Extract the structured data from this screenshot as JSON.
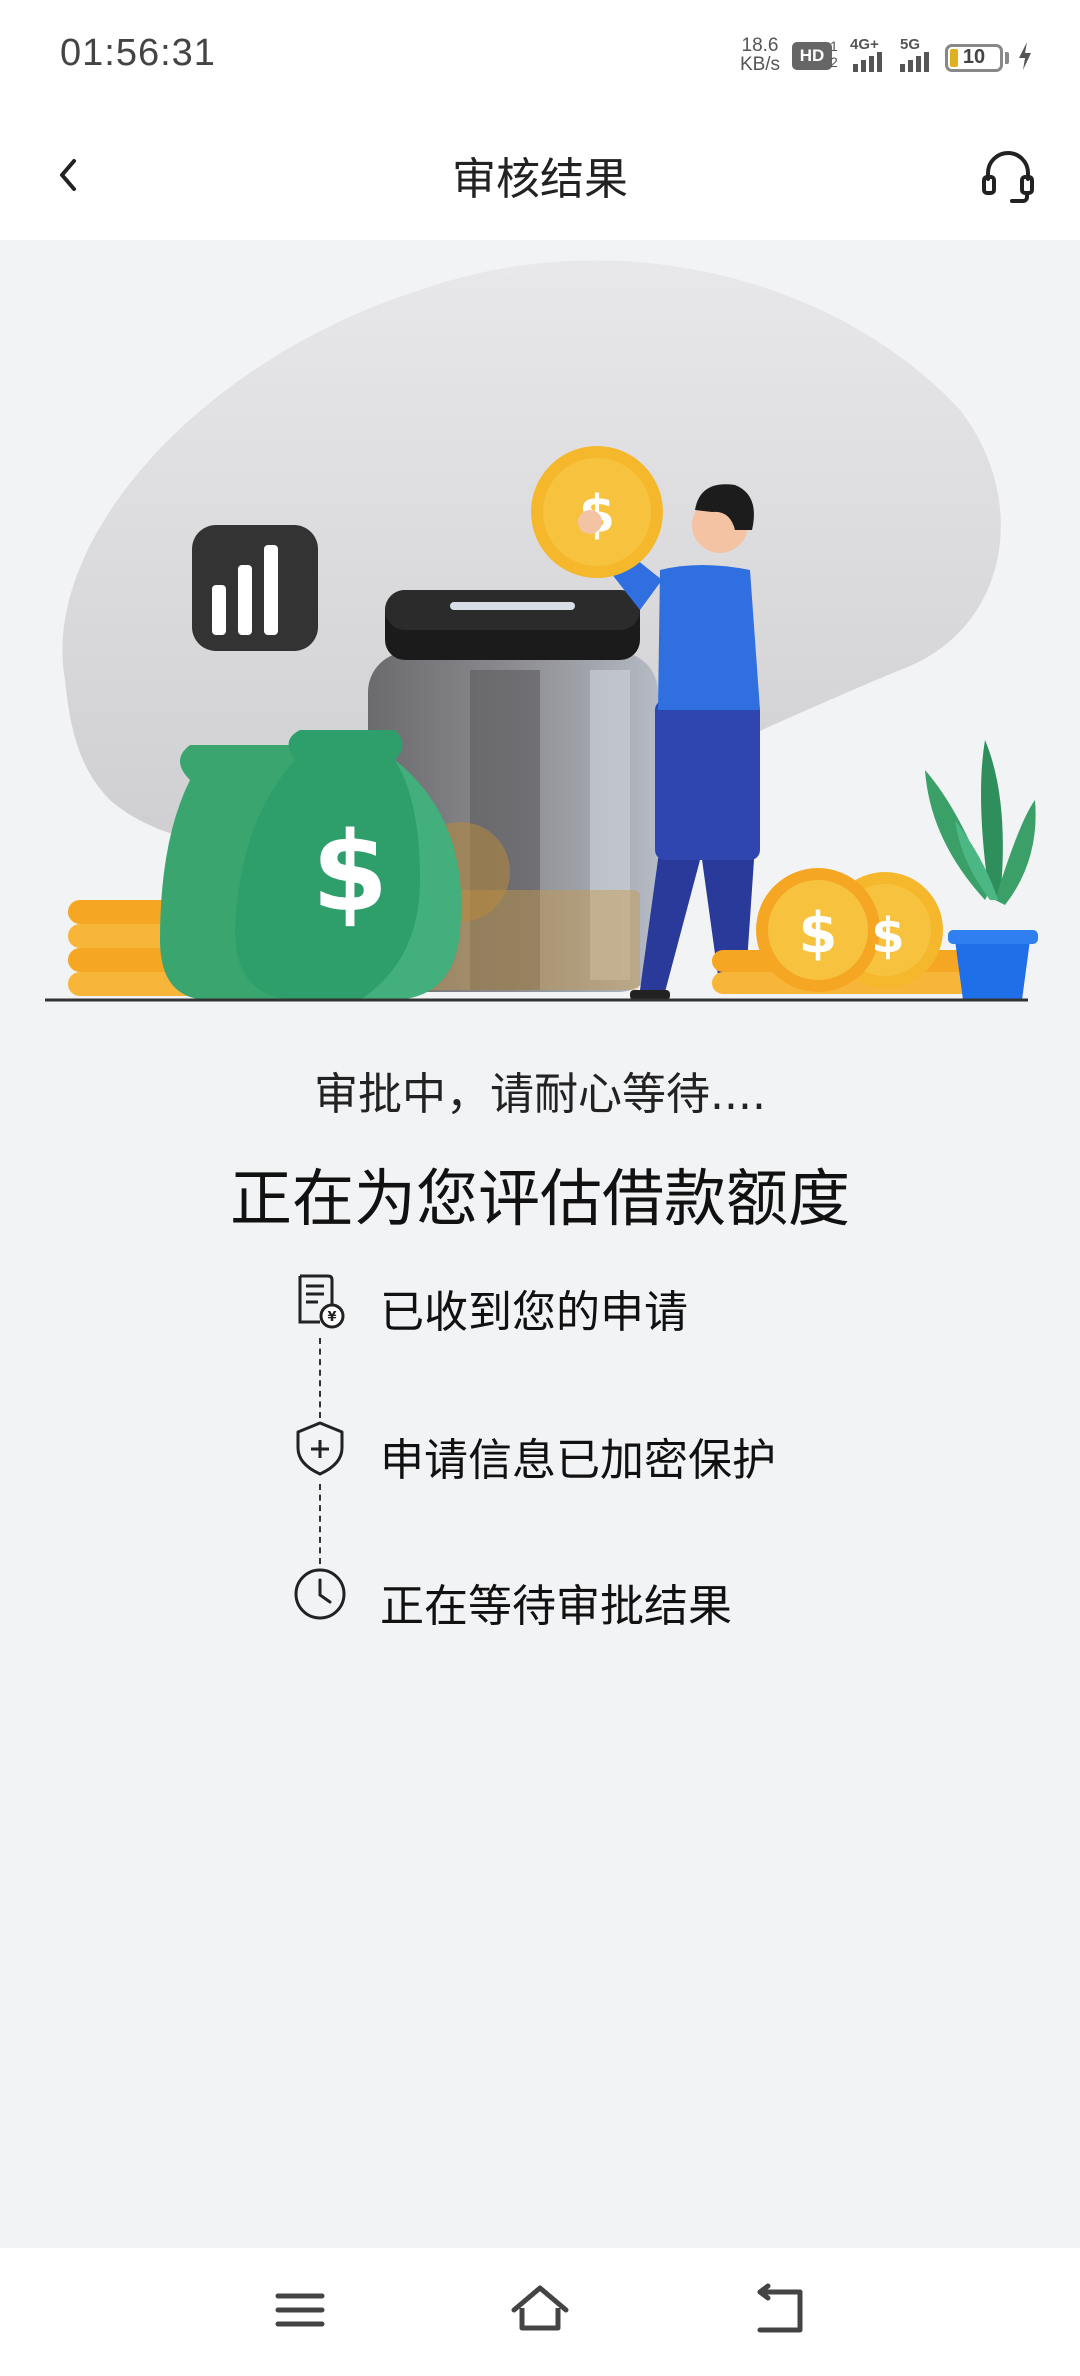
{
  "status_bar": {
    "time": "01:56:31",
    "net_speed_value": "18.6",
    "net_speed_unit": "KB/s",
    "hd_badge": "HD",
    "hd_sub_top": "1",
    "hd_sub_bottom": "2",
    "network_1": "4G+",
    "network_2": "5G",
    "battery_level": "10"
  },
  "header": {
    "title": "审核结果",
    "back_icon": "chevron-left-icon",
    "support_icon": "headset-icon"
  },
  "main": {
    "subtitle": "审批中，请耐心等待....",
    "headline": "正在为您评估借款额度",
    "steps": [
      {
        "label": "已收到您的申请",
        "icon": "receipt-yen-icon"
      },
      {
        "label": "申请信息已加密保护",
        "icon": "shield-plus-icon"
      },
      {
        "label": "正在等待审批结果",
        "icon": "clock-icon"
      }
    ]
  },
  "nav": {
    "menu_icon": "menu-icon",
    "home_icon": "home-icon",
    "back_icon": "back-arrow-icon"
  },
  "colors": {
    "background": "#f2f3f5",
    "money_green": "#2e9e6a",
    "coin_yellow": "#f5b72c",
    "person_blue": "#2f6fe0",
    "plant_green": "#3aa068",
    "pot_blue": "#1f6fe8"
  }
}
